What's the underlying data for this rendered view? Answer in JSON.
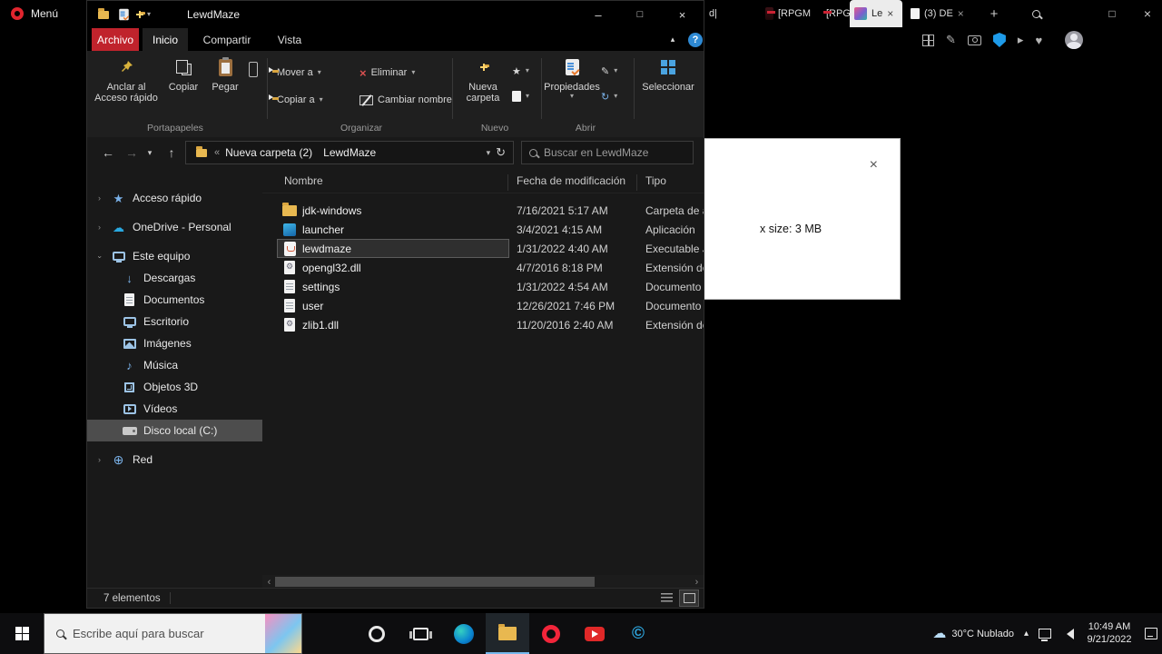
{
  "colors": {
    "file_tab_red": "#c0232c",
    "taskbar_accent": "#76b9ed",
    "file_selection_bg": "#2f2f2f",
    "sidebar_selected_bg": "#4d4d4d",
    "dialog_bg": "#ffffff"
  },
  "glyphs": {
    "chevron_down": "▾",
    "chevron_up": "▴",
    "chevron_left": "‹",
    "chevron_right": "›",
    "double_chevron": "«",
    "back_arrow": "←",
    "forward_arrow": "→",
    "up_arrow": "↑",
    "refresh": "↻",
    "minimize": "–",
    "maximize": "□",
    "close": "×",
    "help": "?",
    "plus": "+",
    "star": "★",
    "cloud": "☁",
    "download_arrow": "↓",
    "music_note": "♪",
    "globe": "⊕",
    "copyright": "©",
    "delete_x": "×",
    "pencil": "✎",
    "gear": "⚙",
    "heart": "♥",
    "send": "▸"
  },
  "opera": {
    "menu_label": "Menú",
    "tabstrip": {
      "partial_tab_text": "d|",
      "rpgm_tab_1": "[RPGM",
      "rpgm_tab_2": "[RPGM",
      "active_tab_label": "Le",
      "de_tab_label": "(3) DE"
    }
  },
  "dialog": {
    "text_fragment": "x size: 3 MB"
  },
  "explorer": {
    "title": "LewdMaze",
    "tabs": {
      "file": "Archivo",
      "home": "Inicio",
      "share": "Compartir",
      "view": "Vista"
    },
    "ribbon": {
      "pin_label": "Anclar al Acceso rápido",
      "copy_label": "Copiar",
      "paste_label": "Pegar",
      "move_to_label": "Mover a",
      "copy_to_label": "Copiar a",
      "delete_label": "Eliminar",
      "rename_label": "Cambiar nombre",
      "new_folder_label": "Nueva carpeta",
      "properties_label": "Propiedades",
      "select_label": "Seleccionar",
      "group_clipboard": "Portapapeles",
      "group_organize": "Organizar",
      "group_new": "Nuevo",
      "group_open": "Abrir"
    },
    "address": {
      "crumb_root": "Nueva carpeta (2)",
      "crumb_current": "LewdMaze",
      "search_placeholder": "Buscar en LewdMaze"
    },
    "sidebar": {
      "quick_access": "Acceso rápido",
      "onedrive": "OneDrive - Personal",
      "this_pc": "Este equipo",
      "downloads": "Descargas",
      "documents": "Documentos",
      "desktop": "Escritorio",
      "pictures": "Imágenes",
      "music": "Música",
      "objects3d": "Objetos 3D",
      "videos": "Vídeos",
      "local_disk": "Disco local (C:)",
      "network": "Red"
    },
    "columns": {
      "name": "Nombre",
      "modified": "Fecha de modificación",
      "type": "Tipo"
    },
    "files": [
      {
        "name": "jdk-windows",
        "modified": "7/16/2021 5:17 AM",
        "type": "Carpeta de a"
      },
      {
        "name": "launcher",
        "modified": "3/4/2021 4:15 AM",
        "type": "Aplicación"
      },
      {
        "name": "lewdmaze",
        "modified": "1/31/2022 4:40 AM",
        "type": "Executable J"
      },
      {
        "name": "opengl32.dll",
        "modified": "4/7/2016 8:18 PM",
        "type": "Extensión de"
      },
      {
        "name": "settings",
        "modified": "1/31/2022 4:54 AM",
        "type": "Documento"
      },
      {
        "name": "user",
        "modified": "12/26/2021 7:46 PM",
        "type": "Documento"
      },
      {
        "name": "zlib1.dll",
        "modified": "11/20/2016 2:40 AM",
        "type": "Extensión de"
      }
    ],
    "status": {
      "items_count": "7 elementos"
    }
  },
  "taskbar": {
    "search_placeholder": "Escribe aquí para buscar",
    "tray": {
      "weather_text": "30°C Nublado",
      "time": "10:49 AM",
      "date": "9/21/2022"
    }
  }
}
